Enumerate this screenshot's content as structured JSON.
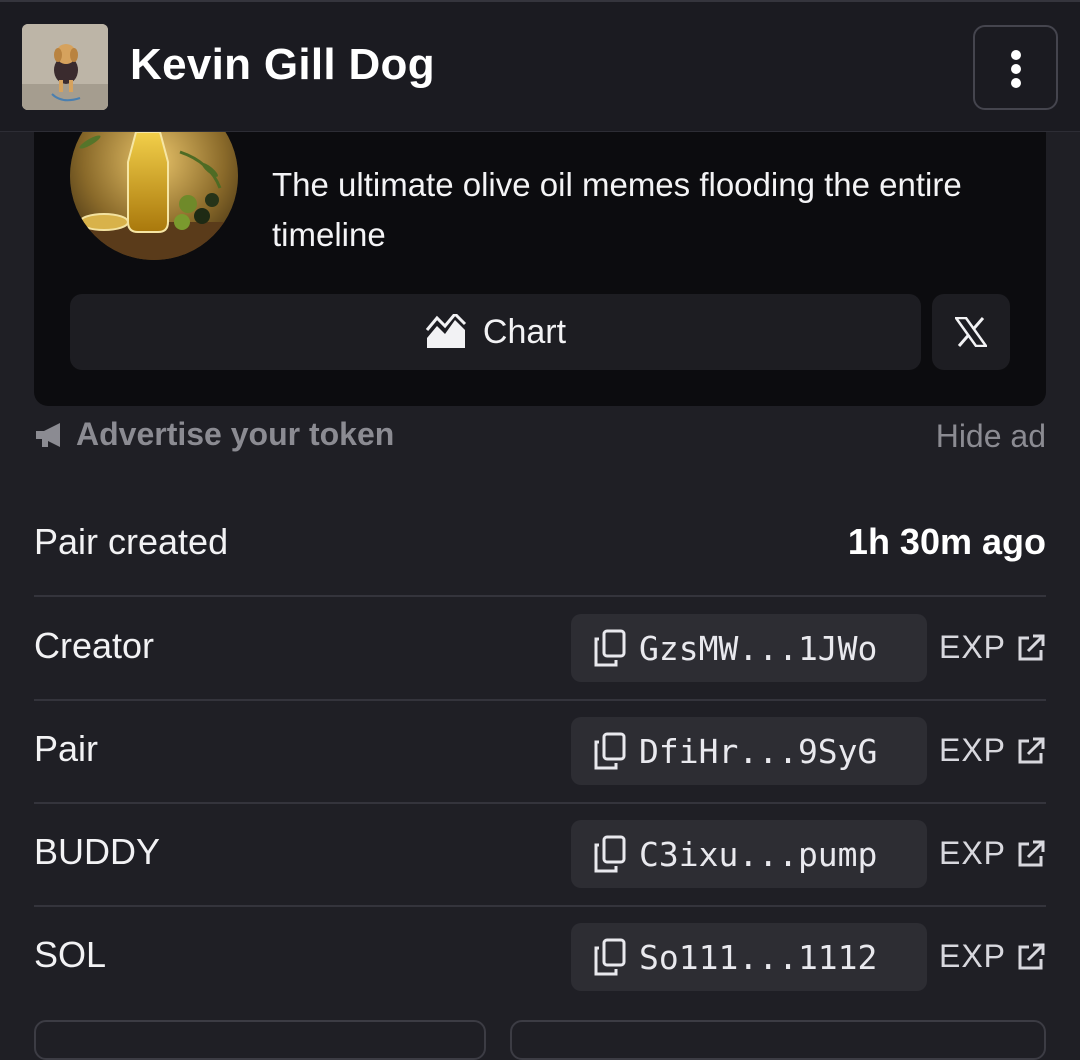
{
  "header": {
    "title": "Kevin Gill Dog",
    "menu_icon": "vertical-ellipsis-icon"
  },
  "ad": {
    "description": "The ultimate olive oil memes flooding the entire timeline",
    "chart_label": "Chart",
    "chart_icon": "chart-area-icon",
    "x_icon": "x-logo-icon"
  },
  "advertise": {
    "label": "Advertise your token",
    "icon": "megaphone-icon",
    "hide_label": "Hide ad"
  },
  "info": {
    "pair_created": {
      "label": "Pair created",
      "value": "1h 30m ago"
    },
    "rows": [
      {
        "label": "Creator",
        "address": "GzsMW...1JWo",
        "exp": "EXP"
      },
      {
        "label": "Pair",
        "address": "DfiHr...9SyG",
        "exp": "EXP"
      },
      {
        "label": "BUDDY",
        "address": "C3ixu...pump",
        "exp": "EXP"
      },
      {
        "label": "SOL",
        "address": "So111...1112",
        "exp": "EXP"
      }
    ]
  },
  "colors": {
    "background": "#1f1f25",
    "card": "#0c0c0f",
    "chip": "#2d2d33",
    "muted_text": "#8b8b92"
  }
}
